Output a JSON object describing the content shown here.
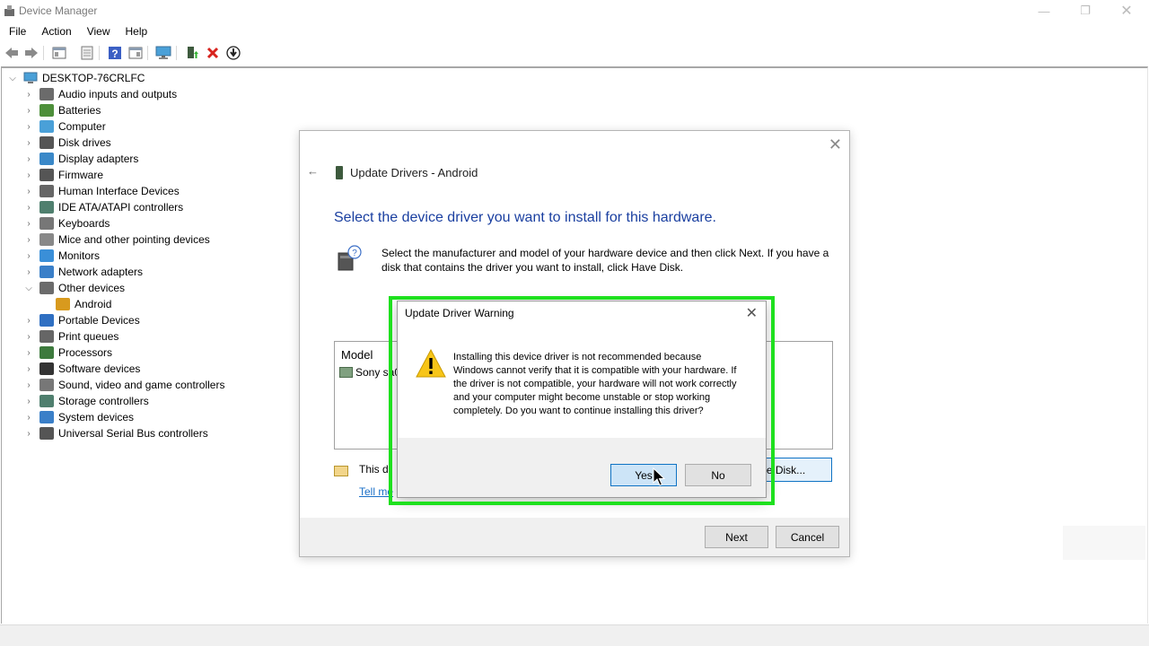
{
  "window": {
    "title": "Device Manager"
  },
  "menu": [
    "File",
    "Action",
    "View",
    "Help"
  ],
  "tree": {
    "root": "DESKTOP-76CRLFC",
    "items": [
      {
        "label": "Audio inputs and outputs",
        "icon": "speaker-icon",
        "expanded": false
      },
      {
        "label": "Batteries",
        "icon": "battery-icon",
        "expanded": false
      },
      {
        "label": "Computer",
        "icon": "computer-icon",
        "expanded": false
      },
      {
        "label": "Disk drives",
        "icon": "disk-icon",
        "expanded": false
      },
      {
        "label": "Display adapters",
        "icon": "display-adapter-icon",
        "expanded": false
      },
      {
        "label": "Firmware",
        "icon": "firmware-icon",
        "expanded": false
      },
      {
        "label": "Human Interface Devices",
        "icon": "hid-icon",
        "expanded": false
      },
      {
        "label": "IDE ATA/ATAPI controllers",
        "icon": "ide-icon",
        "expanded": false
      },
      {
        "label": "Keyboards",
        "icon": "keyboard-icon",
        "expanded": false
      },
      {
        "label": "Mice and other pointing devices",
        "icon": "mouse-icon",
        "expanded": false
      },
      {
        "label": "Monitors",
        "icon": "monitor-icon",
        "expanded": false
      },
      {
        "label": "Network adapters",
        "icon": "network-icon",
        "expanded": false
      },
      {
        "label": "Other devices",
        "icon": "other-devices-icon",
        "expanded": true
      },
      {
        "label": "Android",
        "icon": "warning-device-icon",
        "child": true
      },
      {
        "label": "Portable Devices",
        "icon": "portable-icon",
        "expanded": false
      },
      {
        "label": "Print queues",
        "icon": "printer-icon",
        "expanded": false
      },
      {
        "label": "Processors",
        "icon": "processor-icon",
        "expanded": false
      },
      {
        "label": "Software devices",
        "icon": "software-icon",
        "expanded": false
      },
      {
        "label": "Sound, video and game controllers",
        "icon": "sound-icon",
        "expanded": false
      },
      {
        "label": "Storage controllers",
        "icon": "storage-icon",
        "expanded": false
      },
      {
        "label": "System devices",
        "icon": "system-icon",
        "expanded": false
      },
      {
        "label": "Universal Serial Bus controllers",
        "icon": "usb-icon",
        "expanded": false
      }
    ]
  },
  "wizard": {
    "title": "Update Drivers - Android",
    "heading": "Select the device driver you want to install for this hardware.",
    "instructions": "Select the manufacturer and model of your hardware device and then click Next. If you have a disk that contains the driver you want to install, click Have Disk.",
    "model_header": "Model",
    "model_item": "Sony sa0",
    "signed_text": "This dr",
    "tell_me": "Tell me",
    "have_disk": "ve Disk...",
    "next": "Next",
    "cancel": "Cancel"
  },
  "warning": {
    "title": "Update Driver Warning",
    "message": "Installing this device driver is not recommended because Windows cannot verify that it is compatible with your hardware.  If the driver is not compatible, your hardware will not work correctly and your computer might become unstable or stop working completely.  Do you want to continue installing this driver?",
    "yes": "Yes",
    "no": "No"
  },
  "colors": {
    "highlight": "#1ee01e",
    "accent": "#0f73c4",
    "heading": "#1a3fa0",
    "link": "#1a6fc7"
  }
}
